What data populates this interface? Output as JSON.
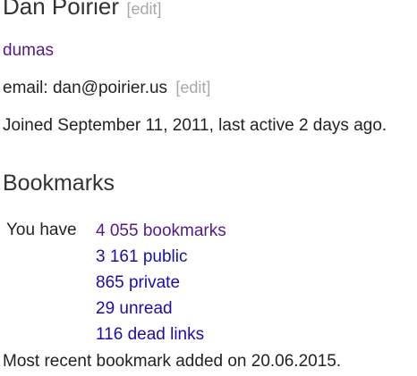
{
  "profile": {
    "name": "Dan Poirier",
    "name_edit_label": "[edit]",
    "nickname": "dumas",
    "email_label": "email:",
    "email": "dan@poirier.us",
    "email_edit_label": "[edit]",
    "joined_text": "Joined September 11, 2011, last active 2 days ago."
  },
  "bookmarks": {
    "heading": "Bookmarks",
    "you_have_label": "You have",
    "stats": [
      {
        "label": "4 055 bookmarks",
        "visited": true
      },
      {
        "label": "3 161 public",
        "visited": false
      },
      {
        "label": "865 private",
        "visited": false
      },
      {
        "label": "29 unread",
        "visited": false
      },
      {
        "label": "116 dead links",
        "visited": false
      }
    ],
    "most_recent_text": "Most recent bookmark added on 20.06.2015."
  },
  "colors": {
    "link": "#1a0dab",
    "visited_link": "#551a8b",
    "muted_edit": "#a8a8a8",
    "text": "#222222"
  }
}
